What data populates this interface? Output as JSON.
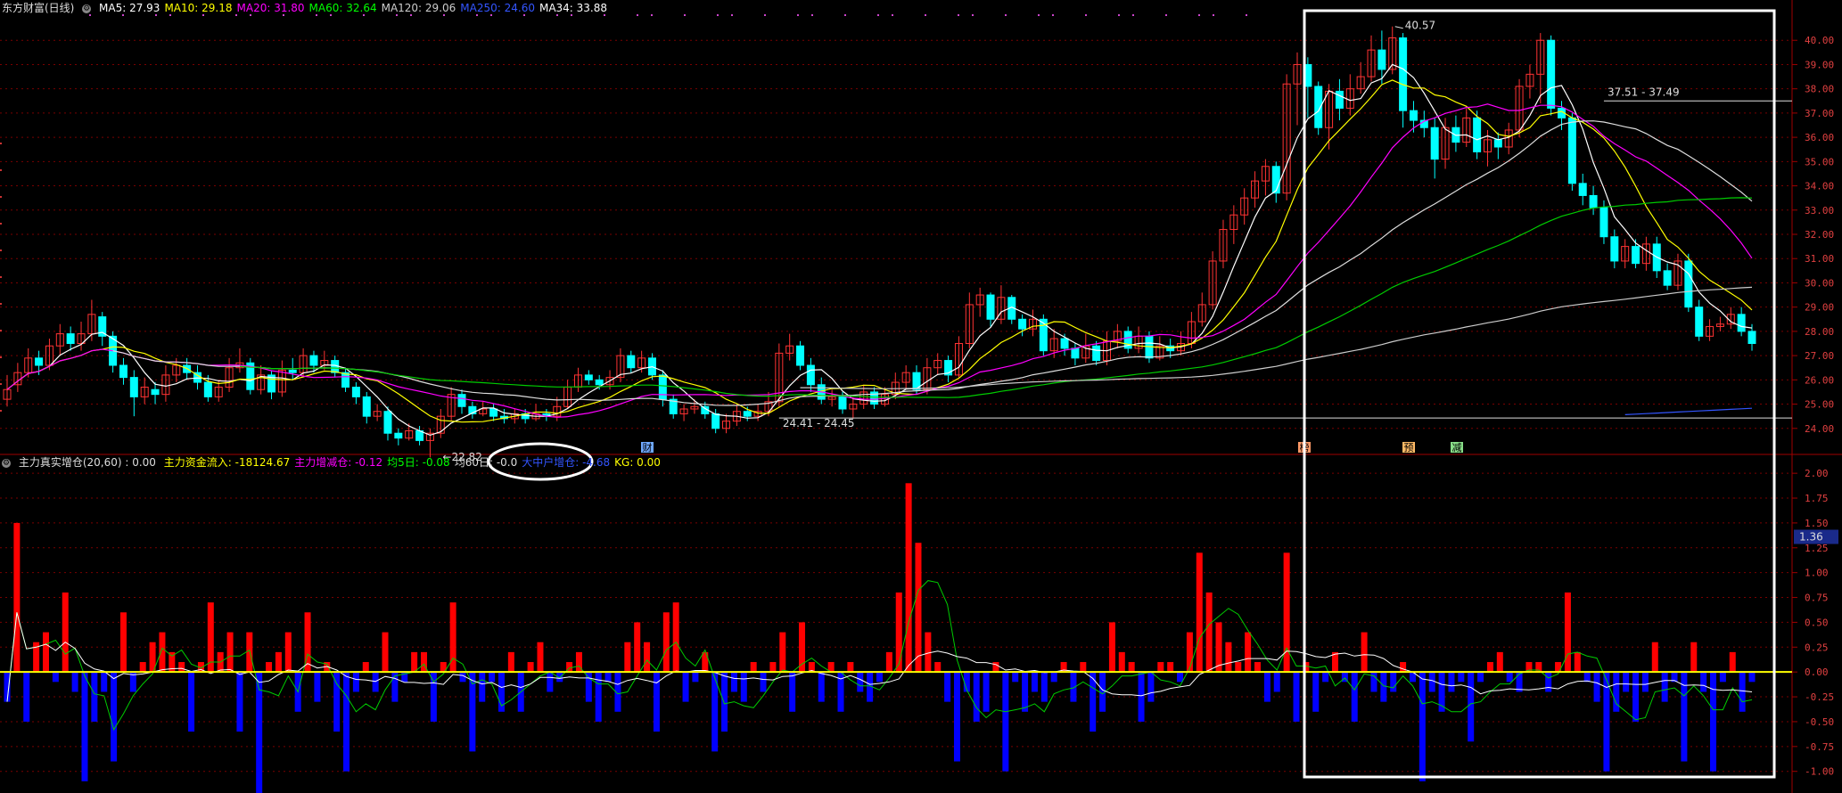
{
  "header": {
    "title": "东方财富(日线)",
    "ma": [
      {
        "label": "MA5:",
        "value": "27.93",
        "color": "#ffffff"
      },
      {
        "label": "MA10:",
        "value": "29.18",
        "color": "#ffff00"
      },
      {
        "label": "MA20:",
        "value": "31.80",
        "color": "#ff00ff"
      },
      {
        "label": "MA60:",
        "value": "32.64",
        "color": "#00ff00"
      },
      {
        "label": "MA120:",
        "value": "29.06",
        "color": "#cccccc"
      },
      {
        "label": "MA250:",
        "value": "24.60",
        "color": "#3355ff"
      },
      {
        "label": "MA34:",
        "value": "33.88",
        "color": "#ffffff"
      }
    ]
  },
  "indicator_header": {
    "name": "主力真实增仓(20,60) : 0.00",
    "items": [
      {
        "label": "主力资金流入:",
        "value": "-18124.67",
        "color": "#ffff00"
      },
      {
        "label": "主力增减仓:",
        "value": "-0.12",
        "color": "#ff00ff"
      },
      {
        "label": "均5日:",
        "value": "-0.08",
        "color": "#00ff00"
      },
      {
        "label": "均60日:",
        "value": "-0.0",
        "color": "#dddddd"
      },
      {
        "label": "大中户增仓:",
        "value": "-4.68",
        "color": "#3355ff"
      },
      {
        "label": "KG:",
        "value": "0.00",
        "color": "#ffff00"
      }
    ]
  },
  "annotations": {
    "high": "40.57",
    "low": "22.82",
    "range1": "37.51 - 37.49",
    "range2": "24.41 - 24.45",
    "current_indicator": "1.36",
    "tag_cai": "财",
    "tag_ke": "榜",
    "tag_yu": "预",
    "tag_jian": "减"
  },
  "colors": {
    "up": "#ff3333",
    "down": "#00ffff",
    "ma5": "#ffffff",
    "ma10": "#ffff00",
    "ma20": "#ff00ff",
    "ma60": "#00cc00",
    "ma120": "#cccccc",
    "ma250": "#3355ff",
    "bar_pos": "#ff0000",
    "bar_neg": "#0000ff",
    "grid": "#7a0000",
    "box": "#ffffff"
  },
  "chart_data": [
    {
      "type": "candlestick",
      "title": "东方财富(日线)",
      "y_ticks": [
        "40.00",
        "39.00",
        "38.00",
        "37.00",
        "36.00",
        "35.00",
        "34.00",
        "33.00",
        "32.00",
        "31.00",
        "30.00",
        "29.00",
        "28.00",
        "27.00",
        "26.00",
        "25.00",
        "24.00"
      ],
      "ylim": [
        23.0,
        41.0
      ],
      "candles": [
        [
          25.2,
          25.6,
          26.2,
          24.9
        ],
        [
          25.8,
          26.3,
          26.7,
          25.5
        ],
        [
          26.3,
          26.9,
          27.3,
          26.1
        ],
        [
          26.9,
          26.6,
          27.2,
          26.2
        ],
        [
          26.6,
          27.4,
          27.7,
          26.4
        ],
        [
          27.4,
          27.9,
          28.3,
          27.0
        ],
        [
          27.9,
          27.5,
          28.2,
          27.2
        ],
        [
          27.5,
          27.9,
          28.4,
          27.2
        ],
        [
          27.9,
          28.7,
          29.3,
          27.6
        ],
        [
          28.6,
          27.8,
          28.8,
          27.4
        ],
        [
          27.8,
          26.6,
          28.0,
          26.3
        ],
        [
          26.6,
          26.1,
          26.9,
          25.8
        ],
        [
          26.1,
          25.3,
          26.4,
          24.5
        ],
        [
          25.3,
          25.7,
          26.1,
          25.0
        ],
        [
          25.6,
          25.4,
          25.9,
          25.0
        ],
        [
          25.4,
          26.2,
          26.6,
          25.1
        ],
        [
          26.2,
          26.6,
          26.9,
          25.9
        ],
        [
          26.6,
          26.3,
          26.9,
          26.0
        ],
        [
          26.3,
          25.9,
          26.6,
          25.6
        ],
        [
          25.9,
          25.3,
          26.2,
          25.1
        ],
        [
          25.3,
          25.7,
          26.0,
          25.1
        ],
        [
          25.7,
          26.5,
          26.9,
          25.5
        ],
        [
          26.5,
          26.7,
          27.3,
          26.3
        ],
        [
          26.7,
          25.6,
          26.9,
          25.4
        ],
        [
          25.6,
          26.2,
          26.6,
          25.4
        ],
        [
          26.2,
          25.5,
          26.4,
          25.2
        ],
        [
          25.5,
          26.4,
          26.8,
          25.3
        ],
        [
          26.4,
          26.3,
          26.9,
          26.0
        ],
        [
          26.3,
          27.0,
          27.3,
          26.1
        ],
        [
          27.0,
          26.6,
          27.2,
          26.3
        ],
        [
          26.6,
          26.8,
          27.2,
          26.4
        ],
        [
          26.8,
          26.3,
          27.0,
          26.1
        ],
        [
          26.3,
          25.7,
          26.5,
          25.5
        ],
        [
          25.7,
          25.3,
          25.9,
          25.0
        ],
        [
          25.3,
          24.5,
          25.5,
          24.2
        ],
        [
          24.5,
          24.7,
          25.0,
          24.3
        ],
        [
          24.7,
          23.8,
          24.9,
          23.5
        ],
        [
          23.8,
          23.6,
          24.0,
          23.3
        ],
        [
          23.6,
          23.9,
          24.2,
          23.5
        ],
        [
          23.9,
          23.5,
          24.1,
          23.3
        ],
        [
          23.5,
          23.8,
          24.0,
          22.8
        ],
        [
          23.8,
          24.5,
          24.8,
          23.6
        ],
        [
          24.5,
          25.4,
          25.7,
          24.3
        ],
        [
          25.4,
          24.9,
          25.6,
          24.6
        ],
        [
          24.9,
          24.6,
          25.1,
          24.4
        ],
        [
          24.6,
          24.8,
          25.1,
          24.5
        ],
        [
          24.8,
          24.5,
          25.0,
          24.3
        ],
        [
          24.5,
          24.4,
          24.8,
          24.2
        ],
        [
          24.4,
          24.6,
          24.8,
          24.2
        ],
        [
          24.6,
          24.4,
          24.8,
          24.2
        ],
        [
          24.4,
          24.6,
          25.0,
          24.3
        ],
        [
          24.6,
          24.5,
          24.8,
          24.3
        ],
        [
          24.5,
          24.9,
          25.3,
          24.3
        ],
        [
          24.9,
          25.7,
          26.0,
          24.8
        ],
        [
          25.7,
          26.2,
          26.5,
          25.5
        ],
        [
          26.2,
          26.0,
          26.4,
          25.8
        ],
        [
          26.0,
          25.8,
          26.2,
          25.6
        ],
        [
          25.8,
          26.1,
          26.4,
          25.6
        ],
        [
          26.1,
          27.0,
          27.3,
          25.9
        ],
        [
          27.0,
          26.5,
          27.2,
          26.3
        ],
        [
          26.5,
          26.9,
          27.2,
          26.3
        ],
        [
          26.9,
          26.2,
          27.1,
          26.0
        ],
        [
          26.2,
          25.2,
          26.4,
          24.9
        ],
        [
          25.2,
          24.6,
          25.4,
          24.4
        ],
        [
          24.6,
          24.8,
          25.0,
          24.3
        ],
        [
          24.8,
          24.9,
          25.2,
          24.6
        ],
        [
          24.9,
          24.6,
          25.1,
          24.4
        ],
        [
          24.6,
          24.0,
          24.8,
          23.8
        ],
        [
          24.0,
          24.3,
          24.6,
          23.8
        ],
        [
          24.3,
          24.7,
          25.0,
          24.1
        ],
        [
          24.7,
          24.5,
          24.9,
          24.3
        ],
        [
          24.5,
          24.7,
          25.0,
          24.3
        ],
        [
          24.7,
          25.1,
          25.5,
          24.5
        ],
        [
          25.1,
          27.1,
          27.5,
          24.9
        ],
        [
          27.1,
          27.4,
          27.9,
          26.8
        ],
        [
          27.4,
          26.6,
          27.6,
          26.4
        ],
        [
          26.6,
          25.8,
          26.9,
          25.5
        ],
        [
          25.8,
          25.2,
          26.1,
          25.0
        ],
        [
          25.2,
          25.3,
          25.6,
          24.9
        ],
        [
          25.3,
          24.8,
          25.5,
          24.6
        ],
        [
          24.8,
          25.0,
          25.3,
          24.4
        ],
        [
          25.0,
          25.5,
          25.8,
          24.8
        ],
        [
          25.5,
          25.0,
          25.7,
          24.8
        ],
        [
          25.0,
          25.4,
          25.7,
          24.9
        ],
        [
          25.4,
          25.9,
          26.3,
          25.2
        ],
        [
          25.9,
          26.3,
          26.6,
          25.6
        ],
        [
          26.3,
          25.6,
          26.6,
          25.4
        ],
        [
          25.6,
          26.5,
          26.9,
          25.4
        ],
        [
          26.5,
          26.8,
          27.1,
          26.2
        ],
        [
          26.8,
          26.2,
          27.0,
          25.9
        ],
        [
          26.2,
          27.5,
          27.8,
          26.1
        ],
        [
          27.5,
          29.1,
          29.6,
          27.3
        ],
        [
          29.1,
          29.5,
          29.8,
          28.6
        ],
        [
          29.5,
          28.5,
          29.6,
          28.2
        ],
        [
          28.5,
          29.4,
          29.9,
          28.3
        ],
        [
          29.4,
          28.5,
          29.5,
          28.3
        ],
        [
          28.5,
          28.1,
          28.7,
          27.8
        ],
        [
          28.1,
          28.5,
          28.9,
          27.8
        ],
        [
          28.5,
          27.2,
          28.7,
          27.0
        ],
        [
          27.2,
          27.7,
          28.1,
          26.9
        ],
        [
          27.7,
          27.3,
          27.9,
          27.0
        ],
        [
          27.3,
          26.9,
          27.5,
          26.6
        ],
        [
          26.9,
          27.4,
          27.9,
          26.7
        ],
        [
          27.4,
          26.8,
          27.6,
          26.6
        ],
        [
          26.8,
          27.6,
          28.0,
          26.6
        ],
        [
          27.6,
          28.0,
          28.3,
          27.3
        ],
        [
          28.0,
          27.3,
          28.2,
          27.1
        ],
        [
          27.3,
          27.8,
          28.2,
          27.1
        ],
        [
          27.8,
          26.9,
          28.0,
          26.7
        ],
        [
          26.9,
          27.4,
          27.8,
          26.8
        ],
        [
          27.4,
          27.2,
          27.7,
          26.9
        ],
        [
          27.2,
          27.5,
          28.0,
          27.0
        ],
        [
          27.5,
          28.4,
          28.8,
          27.3
        ],
        [
          28.4,
          29.1,
          29.6,
          28.2
        ],
        [
          29.1,
          30.9,
          31.3,
          28.9
        ],
        [
          30.9,
          32.2,
          32.6,
          30.6
        ],
        [
          32.2,
          32.8,
          33.2,
          31.6
        ],
        [
          32.8,
          33.5,
          33.9,
          32.4
        ],
        [
          33.5,
          34.2,
          34.6,
          33.1
        ],
        [
          34.2,
          34.8,
          35.1,
          33.6
        ],
        [
          34.8,
          33.7,
          35.0,
          33.3
        ],
        [
          33.7,
          38.2,
          38.6,
          33.4
        ],
        [
          38.2,
          39.0,
          39.5,
          36.5
        ],
        [
          39.0,
          38.1,
          39.3,
          36.8
        ],
        [
          38.1,
          36.4,
          38.3,
          36.1
        ],
        [
          36.4,
          37.9,
          38.2,
          35.5
        ],
        [
          37.9,
          37.2,
          38.4,
          36.7
        ],
        [
          37.2,
          38.0,
          38.6,
          36.9
        ],
        [
          38.0,
          38.5,
          39.1,
          37.8
        ],
        [
          38.5,
          39.6,
          40.2,
          38.3
        ],
        [
          39.6,
          38.8,
          40.4,
          38.2
        ],
        [
          38.8,
          40.1,
          40.57,
          38.6
        ],
        [
          40.1,
          37.1,
          40.3,
          36.4
        ],
        [
          37.1,
          36.7,
          37.5,
          36.2
        ],
        [
          36.7,
          36.4,
          37.1,
          36.0
        ],
        [
          36.4,
          35.1,
          36.8,
          34.3
        ],
        [
          35.1,
          36.4,
          36.8,
          34.7
        ],
        [
          36.4,
          35.8,
          36.9,
          35.4
        ],
        [
          35.8,
          36.8,
          37.2,
          35.6
        ],
        [
          36.8,
          35.4,
          37.1,
          35.1
        ],
        [
          35.4,
          35.9,
          36.3,
          34.8
        ],
        [
          35.9,
          35.6,
          36.2,
          35.1
        ],
        [
          35.6,
          36.3,
          36.6,
          35.3
        ],
        [
          36.3,
          38.1,
          38.4,
          36.0
        ],
        [
          38.1,
          38.6,
          39.0,
          37.6
        ],
        [
          38.6,
          40.0,
          40.3,
          37.4
        ],
        [
          40.0,
          37.2,
          40.2,
          36.9
        ],
        [
          37.2,
          36.8,
          37.5,
          36.3
        ],
        [
          36.8,
          34.1,
          37.0,
          33.8
        ],
        [
          34.1,
          33.6,
          34.5,
          33.2
        ],
        [
          33.6,
          33.1,
          34.0,
          32.8
        ],
        [
          33.1,
          31.9,
          33.4,
          31.6
        ],
        [
          31.9,
          30.9,
          32.2,
          30.6
        ],
        [
          30.9,
          31.5,
          31.8,
          30.6
        ],
        [
          31.5,
          30.8,
          31.8,
          30.6
        ],
        [
          30.8,
          31.6,
          31.9,
          30.5
        ],
        [
          31.6,
          30.5,
          31.9,
          30.2
        ],
        [
          30.5,
          29.9,
          30.8,
          29.7
        ],
        [
          29.9,
          30.9,
          31.2,
          29.7
        ],
        [
          30.9,
          29.0,
          31.2,
          28.8
        ],
        [
          29.0,
          27.8,
          29.3,
          27.6
        ],
        [
          27.8,
          28.2,
          28.5,
          27.6
        ],
        [
          28.2,
          28.3,
          28.6,
          28.0
        ],
        [
          28.3,
          28.7,
          29.0,
          28.1
        ],
        [
          28.7,
          28.0,
          29.0,
          27.8
        ],
        [
          28.0,
          27.5,
          28.3,
          27.2
        ]
      ]
    },
    {
      "type": "bar",
      "title": "主力真实增仓(20,60)",
      "y_ticks": [
        "2.00",
        "1.75",
        "1.50",
        "1.25",
        "1.00",
        "0.75",
        "0.50",
        "0.25",
        "0.00",
        "-0.25",
        "-0.50",
        "-0.75",
        "-1.00"
      ],
      "ylim": [
        -1.2,
        2.1
      ],
      "values": [
        -0.3,
        1.5,
        -0.5,
        0.3,
        0.4,
        -0.1,
        0.8,
        -0.2,
        -1.1,
        -0.5,
        -0.2,
        -0.9,
        0.6,
        -0.2,
        0.1,
        0.3,
        0.4,
        0.2,
        0.1,
        -0.6,
        0.1,
        0.7,
        0.2,
        0.4,
        -0.6,
        0.4,
        -1.3,
        0.1,
        0.2,
        0.4,
        -0.4,
        0.6,
        -0.3,
        0.1,
        -0.6,
        -1.0,
        -0.2,
        0.1,
        -0.2,
        0.4,
        -0.3,
        -0.1,
        0.2,
        0.2,
        -0.5,
        0.1,
        0.7,
        -0.1,
        -0.8,
        -0.3,
        -0.1,
        -0.4,
        0.2,
        -0.4,
        0.1,
        0.3,
        -0.2,
        -0.1,
        0.1,
        0.2,
        -0.3,
        -0.5,
        -0.1,
        -0.4,
        0.3,
        0.5,
        0.3,
        -0.6,
        0.6,
        0.7,
        -0.3,
        -0.1,
        0.2,
        -0.8,
        -0.6,
        -0.2,
        -0.3,
        0.1,
        -0.2,
        0.1,
        0.4,
        -0.4,
        0.5,
        0.1,
        -0.3,
        0.1,
        -0.4,
        0.1,
        -0.2,
        -0.3,
        -0.1,
        0.2,
        0.8,
        1.9,
        1.3,
        0.4,
        0.1,
        -0.3,
        -0.9,
        -0.2,
        -0.5,
        -0.4,
        0.1,
        -1.0,
        -0.1,
        -0.4,
        -0.2,
        -0.3,
        -0.1,
        0.1,
        -0.3,
        0.1,
        -0.6,
        -0.4,
        0.5,
        0.2,
        0.1,
        -0.5,
        -0.3,
        0.1,
        0.1,
        -0.1,
        0.4,
        1.2,
        0.8,
        0.5,
        0.3,
        0.1,
        0.4,
        0.1,
        -0.3,
        -0.2,
        1.2,
        -0.5,
        0.1,
        -0.4,
        -0.1,
        0.2,
        -0.1,
        -0.5,
        0.4,
        -0.2,
        -0.3,
        -0.2,
        0.1,
        -0.1,
        -1.1,
        -0.2,
        -0.4,
        -0.2,
        -0.1,
        -0.7,
        -0.1,
        0.1,
        0.2,
        -0.1,
        -0.2,
        0.1,
        0.1,
        -0.2,
        0.1,
        0.8,
        0.2,
        -0.1,
        -0.3,
        -1.0,
        -0.4,
        -0.2,
        -0.5,
        -0.2,
        0.3,
        -0.3,
        -0.1,
        -0.9,
        0.3,
        -0.2,
        -1.0,
        -0.1,
        0.2,
        -0.4,
        -0.1
      ]
    }
  ]
}
